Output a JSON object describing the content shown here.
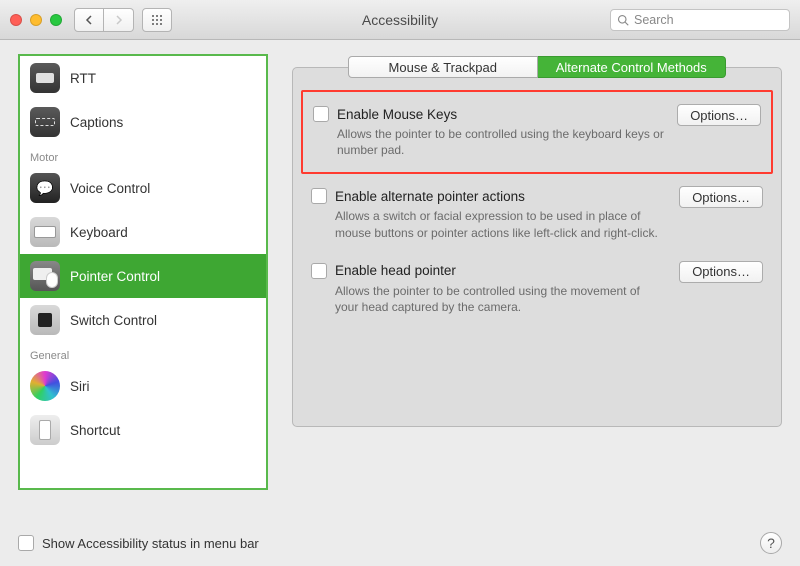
{
  "window": {
    "title": "Accessibility",
    "search_placeholder": "Search"
  },
  "sidebar": {
    "groups": [
      {
        "label": "",
        "items": [
          {
            "label": "RTT"
          },
          {
            "label": "Captions"
          }
        ]
      },
      {
        "label": "Motor",
        "items": [
          {
            "label": "Voice Control"
          },
          {
            "label": "Keyboard"
          },
          {
            "label": "Pointer Control",
            "selected": true
          },
          {
            "label": "Switch Control"
          }
        ]
      },
      {
        "label": "General",
        "items": [
          {
            "label": "Siri"
          },
          {
            "label": "Shortcut"
          }
        ]
      }
    ]
  },
  "tabs": {
    "mouse_trackpad": "Mouse & Trackpad",
    "alt_control": "Alternate Control Methods",
    "active": "alt_control"
  },
  "options": [
    {
      "label": "Enable Mouse Keys",
      "desc": "Allows the pointer to be controlled using the keyboard keys or number pad.",
      "button": "Options…",
      "highlight": true
    },
    {
      "label": "Enable alternate pointer actions",
      "desc": "Allows a switch or facial expression to be used in place of mouse buttons or pointer actions like left-click and right-click.",
      "button": "Options…"
    },
    {
      "label": "Enable head pointer",
      "desc": "Allows the pointer to be controlled using the movement of your head captured by the camera.",
      "button": "Options…"
    }
  ],
  "footer": {
    "status_label": "Show Accessibility status in menu bar"
  }
}
